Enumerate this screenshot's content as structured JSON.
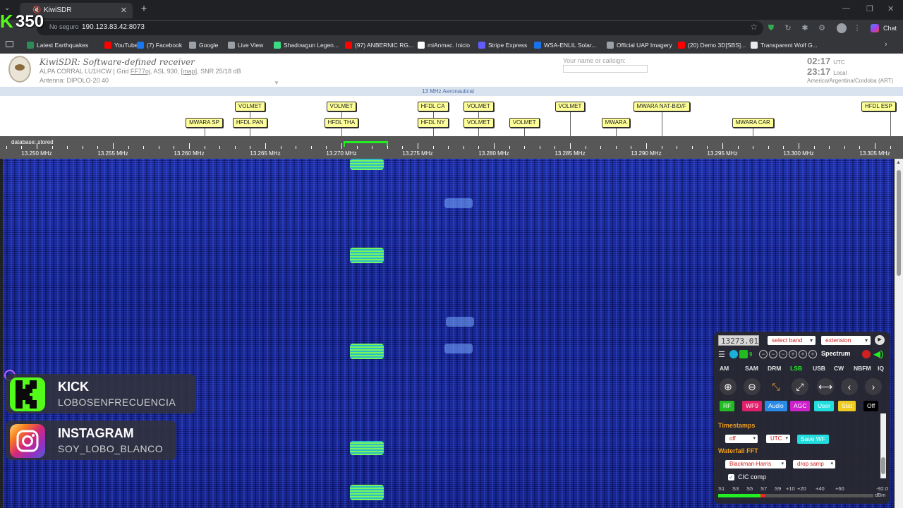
{
  "browser": {
    "tab_title": "KiwiSDR",
    "security": "No seguro",
    "url": "190.123.83.42:8073",
    "chat_label": "Chat",
    "bookmarks": [
      {
        "label": "Latest Earthquakes",
        "color": "#2e8b57"
      },
      {
        "label": "YouTube",
        "color": "#ff0000"
      },
      {
        "label": "(7) Facebook",
        "color": "#1877f2"
      },
      {
        "label": "Google",
        "color": "#9aa0a6"
      },
      {
        "label": "Live View",
        "color": "#9aa0a6"
      },
      {
        "label": "Shadowgun Legen...",
        "color": "#3ddc84"
      },
      {
        "label": "(97) ANBERNIC RG...",
        "color": "#ff0000"
      },
      {
        "label": "miAnmac. Inicio",
        "color": "#ffffff"
      },
      {
        "label": "Stripe Express",
        "color": "#635bff"
      },
      {
        "label": "WSA-ENLIL Solar...",
        "color": "#1a73e8"
      },
      {
        "label": "Official UAP Imagery",
        "color": "#9aa0a6"
      },
      {
        "label": "(20) Demo 3D[SBS]...",
        "color": "#ff0000"
      },
      {
        "label": "Transparent Wolf G...",
        "color": "#e8eaed"
      }
    ]
  },
  "kiwi": {
    "title": "KiwiSDR: Software-defined receiver",
    "location_prefix": "ALPA CORRAL LU1HCW | Grid ",
    "grid": "FF77oj",
    "location_mid": ", ASL 930, ",
    "map_link": "[map]",
    "location_suffix": ", SNR 25/18 dB",
    "antenna": "Antenna: DIPOLO-20 40",
    "name_label": "Your name or callsign:",
    "time_utc": "02:17",
    "utc_unit": "UTC",
    "time_local": "23:17",
    "local_unit": "Local",
    "timezone": "America/Argentina/Cordoba (ART)"
  },
  "band": {
    "name": "13 MHz Aeronautical",
    "database": "database: stored",
    "stations": [
      {
        "label": "VOLMET",
        "freq": 13264.0,
        "row": 0
      },
      {
        "label": "VOLMET",
        "freq": 13270.0,
        "row": 0
      },
      {
        "label": "HFDL CA",
        "freq": 13276.0,
        "row": 0
      },
      {
        "label": "VOLMET",
        "freq": 13279.0,
        "row": 0
      },
      {
        "label": "VOLMET",
        "freq": 13285.0,
        "row": 0
      },
      {
        "label": "MWARA NAT-B/D/F",
        "freq": 13291.0,
        "row": 0
      },
      {
        "label": "HFDL ESP",
        "freq": 13306.0,
        "row": 0
      },
      {
        "label": "MWARA SP",
        "freq": 13261.0,
        "row": 1
      },
      {
        "label": "HFDL PAN",
        "freq": 13264.0,
        "row": 1
      },
      {
        "label": "HFDL THA",
        "freq": 13270.0,
        "row": 1
      },
      {
        "label": "HFDL NY",
        "freq": 13276.0,
        "row": 1
      },
      {
        "label": "VOLMET",
        "freq": 13279.0,
        "row": 1
      },
      {
        "label": "VOLMET",
        "freq": 13282.0,
        "row": 1
      },
      {
        "label": "MWARA",
        "freq": 13288.0,
        "row": 1
      },
      {
        "label": "MWARA CAR",
        "freq": 13297.0,
        "row": 1
      }
    ],
    "scale_labels": [
      {
        "label": "13.250 MHz",
        "freq": 13250
      },
      {
        "label": "13.255 MHz",
        "freq": 13255
      },
      {
        "label": "13.260 MHz",
        "freq": 13260
      },
      {
        "label": "13.265 MHz",
        "freq": 13265
      },
      {
        "label": "13.270 MHz",
        "freq": 13270
      },
      {
        "label": "13.275 MHz",
        "freq": 13275
      },
      {
        "label": "13.280 MHz",
        "freq": 13280
      },
      {
        "label": "13.285 MHz",
        "freq": 13285
      },
      {
        "label": "13.290 MHz",
        "freq": 13290
      },
      {
        "label": "13.295 MHz",
        "freq": 13295
      },
      {
        "label": "13.300 MHz",
        "freq": 13300
      },
      {
        "label": "13.305 MHz",
        "freq": 13305
      }
    ]
  },
  "overlays": {
    "stream_count": "350",
    "kick_title": "KICK",
    "kick_user": "LOBOSENFRECUENCIA",
    "insta_title": "INSTAGRAM",
    "insta_user": "SOY_LOBO_BLANCO",
    "kick_color": "#53fc18"
  },
  "panel": {
    "frequency": "13273.01",
    "band_select": "select band",
    "extension_select": "extension",
    "spectrum_label": "Spectrum",
    "modes": [
      "AM",
      "SAM",
      "DRM",
      "LSB",
      "USB",
      "CW",
      "NBFM",
      "IQ"
    ],
    "active_mode": "LSB",
    "tabs": [
      {
        "label": "RF",
        "color": "#22bb22"
      },
      {
        "label": "WF9",
        "color": "#e0206a"
      },
      {
        "label": "Audio",
        "color": "#2a8ae8"
      },
      {
        "label": "AGC",
        "color": "#cc22cc"
      },
      {
        "label": "User",
        "color": "#22dddd"
      },
      {
        "label": "Stat",
        "color": "#eecc22"
      },
      {
        "label": "Off",
        "color": "#000000"
      }
    ],
    "timestamps_title": "Timestamps",
    "ts_select": "off",
    "utc_select": "UTC",
    "save_wf": "Save WF",
    "fft_title": "Waterfall FFT",
    "window_select": "Blackman-Harris",
    "drop_select": "drop samp",
    "cic_label": "CIC comp",
    "smeter_labels": [
      "S1",
      "S3",
      "S5",
      "S7",
      "S9",
      "+10",
      "+20",
      "+40",
      "+60"
    ],
    "smeter_value": "-92.0",
    "dbm_label": "dBm",
    "smeter_level": 0.28
  }
}
